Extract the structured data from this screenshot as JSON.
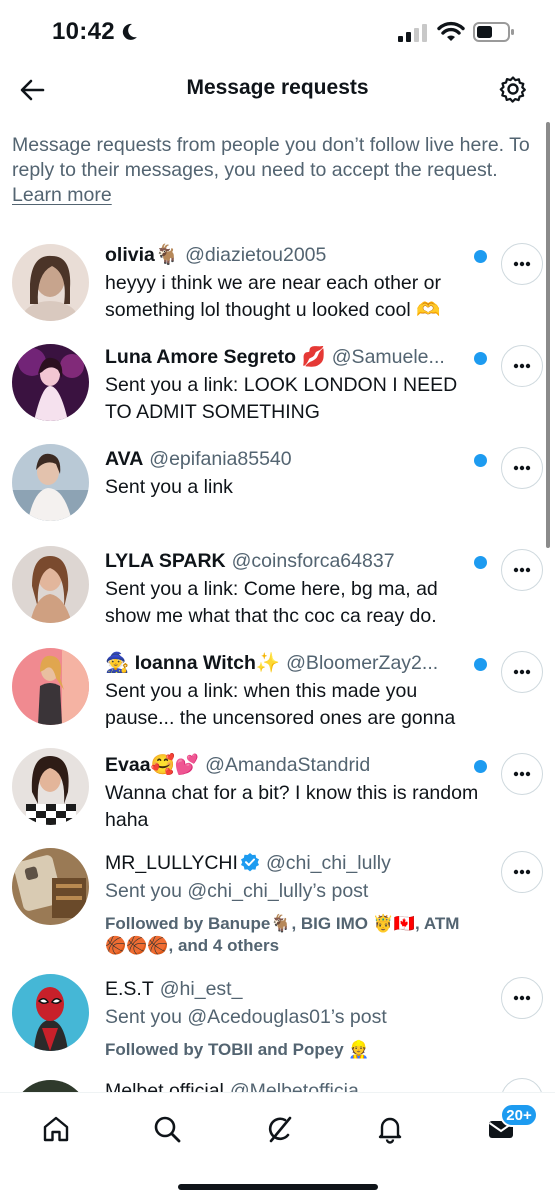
{
  "status_bar": {
    "time": "10:42"
  },
  "header": {
    "title": "Message requests"
  },
  "intro": {
    "text": "Message requests from people you don’t follow live here. To reply to their messages, you need to accept the request.",
    "learn_more": "Learn more"
  },
  "requests": [
    {
      "name": "olivia🐐",
      "handle": "@diazietou2005",
      "message": "heyyy i think we are near each other or something lol thought u looked cool 🫶",
      "unread": true
    },
    {
      "name": "Luna Amore Segreto 💋",
      "handle": "@Samuele...",
      "message": "Sent you a link: LOOK LONDON I NEED TO ADMIT SOMETHING",
      "unread": true
    },
    {
      "name": "AVA",
      "handle": "@epifania85540",
      "message": "Sent you a link",
      "unread": true
    },
    {
      "name": "LYLA SPARK",
      "handle": "@coinsforca64837",
      "message": "Sent you a link: Come here, bg ma, ad show me what that thc coc ca reay do.",
      "unread": true
    },
    {
      "name": "🧙 Ioanna Witch✨",
      "handle": "@BloomerZay2...",
      "message": "Sent you a link: when this made you pause... the uncensored ones are gonna",
      "unread": true
    },
    {
      "name": "Evaa🥰💕",
      "handle": "@AmandaStandrid",
      "message": "Wanna chat for a bit? I know this is random haha",
      "unread": true
    },
    {
      "name": "MR_LULLYCHI",
      "handle": "@chi_chi_lully",
      "message": "Sent you @chi_chi_lully’s post",
      "followed": "Followed by Banupe🐐, BIG IMO 🤴🇨🇦, ATM 🏀🏀🏀, and 4 others",
      "unread": false
    },
    {
      "name": "E.S.T",
      "handle": "@hi_est_",
      "message": "Sent you @Acedouglas01’s post",
      "followed": "Followed by TOBII and Popey 👷",
      "unread": false
    },
    {
      "name": "Melbet official",
      "handle": "@Melbetofficia",
      "message": "",
      "unread": false
    }
  ],
  "nav": {
    "badge": "20+"
  },
  "colors": {
    "accent": "#1d9bf0",
    "secondary_text": "#536471",
    "primary_text": "#0f1419"
  }
}
